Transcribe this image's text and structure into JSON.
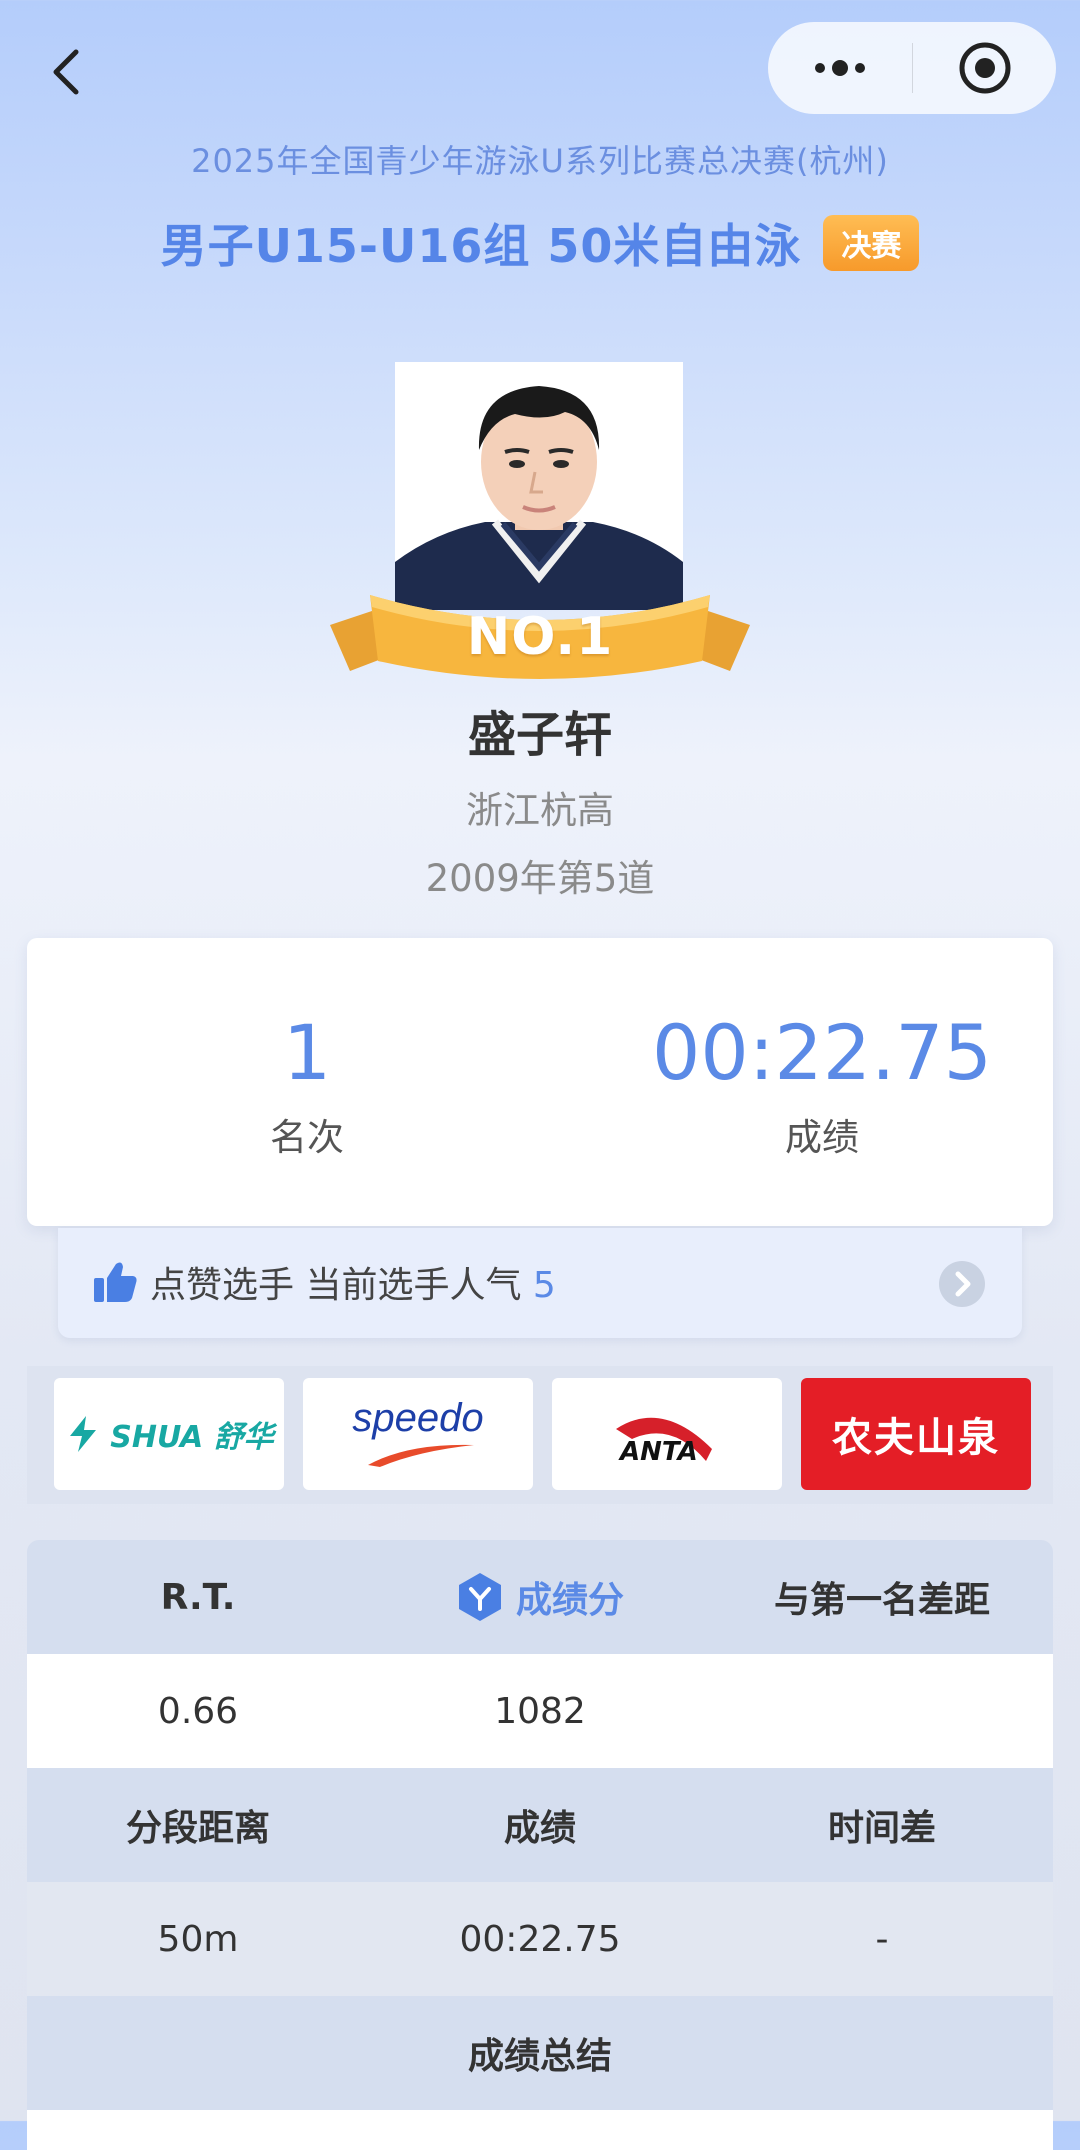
{
  "nav": {
    "back_icon": "chevron-left-icon",
    "more_icon": "more-dots-icon",
    "close_icon": "target-close-icon"
  },
  "competition": "2025年全国青少年游泳U系列比赛总决赛(杭州)",
  "event_title": "男子U15-U16组 50米自由泳",
  "event_tag": "决赛",
  "athlete": {
    "rank_badge": "NO.1",
    "name": "盛子轩",
    "team": "浙江杭高",
    "lane_info": "2009年第5道"
  },
  "result": {
    "rank_value": "1",
    "rank_label": "名次",
    "time_value": "00:22.75",
    "time_label": "成绩"
  },
  "like": {
    "text": "点赞选手 当前选手人气",
    "count": "5"
  },
  "sponsors": [
    {
      "name": "SHUA 舒华",
      "color": "#18a8a3"
    },
    {
      "name": "speedo",
      "color": "#1d3fa8"
    },
    {
      "name": "ANTA",
      "color": "#d6202a"
    },
    {
      "name": "农夫山泉",
      "color": "#e41e26"
    }
  ],
  "table": {
    "headers1": [
      "R.T.",
      "成绩分",
      "与第一名差距"
    ],
    "row1": [
      "0.66",
      "1082",
      ""
    ],
    "headers2": [
      "分段距离",
      "成绩",
      "时间差"
    ],
    "row2": [
      "50m",
      "00:22.75",
      "-"
    ],
    "summary_header": "成绩总结"
  },
  "colors": {
    "accent": "#5b8ae6",
    "tag": "#f9a233",
    "gold": "#f6b13b"
  }
}
